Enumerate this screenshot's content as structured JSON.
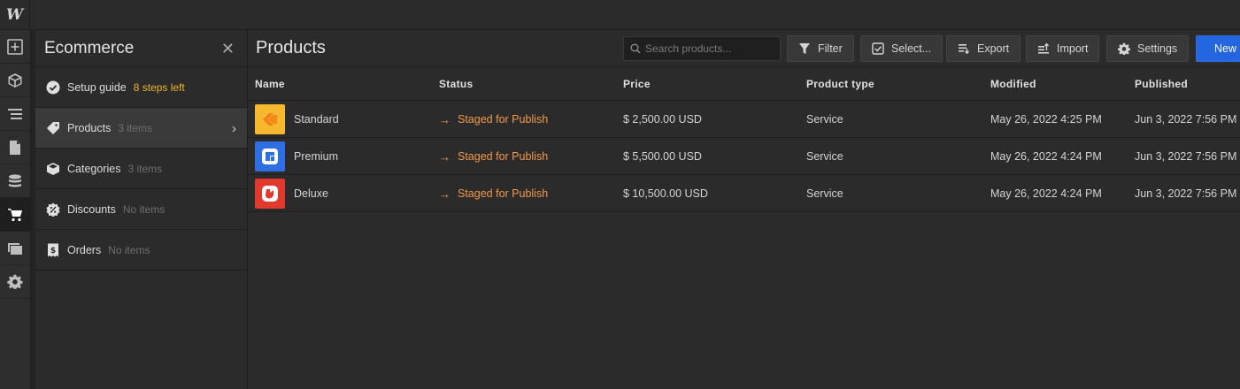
{
  "app": {
    "logo": "W"
  },
  "rail": {
    "items": [
      {
        "name": "add-icon"
      },
      {
        "name": "cube-icon"
      },
      {
        "name": "navigator-icon"
      },
      {
        "name": "pages-icon"
      },
      {
        "name": "cms-icon"
      },
      {
        "name": "cart-icon"
      },
      {
        "name": "assets-icon"
      },
      {
        "name": "settings-icon"
      }
    ],
    "active": "cart-icon"
  },
  "panel": {
    "title": "Ecommerce",
    "close": "✕",
    "items": [
      {
        "label": "Setup guide",
        "sub": "8 steps left",
        "icon": "check-circle-icon"
      },
      {
        "label": "Products",
        "sub": "3 items",
        "icon": "tag-icon"
      },
      {
        "label": "Categories",
        "sub": "3 items",
        "icon": "box-icon"
      },
      {
        "label": "Discounts",
        "sub": "No items",
        "icon": "discount-icon"
      },
      {
        "label": "Orders",
        "sub": "No items",
        "icon": "receipt-icon"
      }
    ],
    "chevron": "›"
  },
  "main": {
    "title": "Products",
    "search_placeholder": "Search products...",
    "buttons": {
      "filter": "Filter",
      "select": "Select...",
      "export": "Export",
      "import": "Import",
      "settings": "Settings",
      "new": "New"
    },
    "columns": [
      "Name",
      "Status",
      "Price",
      "Product type",
      "Modified",
      "Published"
    ],
    "rows": [
      {
        "name": "Standard",
        "status": "Staged for Publish",
        "price": "$ 2,500.00 USD",
        "type": "Service",
        "modified": "May 26, 2022 4:25 PM",
        "published": "Jun 3, 2022 7:56 PM",
        "thumb_color": "#f5b82e",
        "icon_color": "#f57f17"
      },
      {
        "name": "Premium",
        "status": "Staged for Publish",
        "price": "$ 5,500.00 USD",
        "type": "Service",
        "modified": "May 26, 2022 4:24 PM",
        "published": "Jun 3, 2022 7:56 PM",
        "thumb_color": "#2f6fe4",
        "icon_color": "#ffffff"
      },
      {
        "name": "Deluxe",
        "status": "Staged for Publish",
        "price": "$ 10,500.00 USD",
        "type": "Service",
        "modified": "May 26, 2022 4:24 PM",
        "published": "Jun 3, 2022 7:56 PM",
        "thumb_color": "#e03a2f",
        "icon_color": "#ffffff"
      }
    ],
    "status_arrow": "→"
  },
  "colors": {
    "accent": "#2466e0",
    "status": "#f2994a",
    "warning": "#f0b429"
  }
}
